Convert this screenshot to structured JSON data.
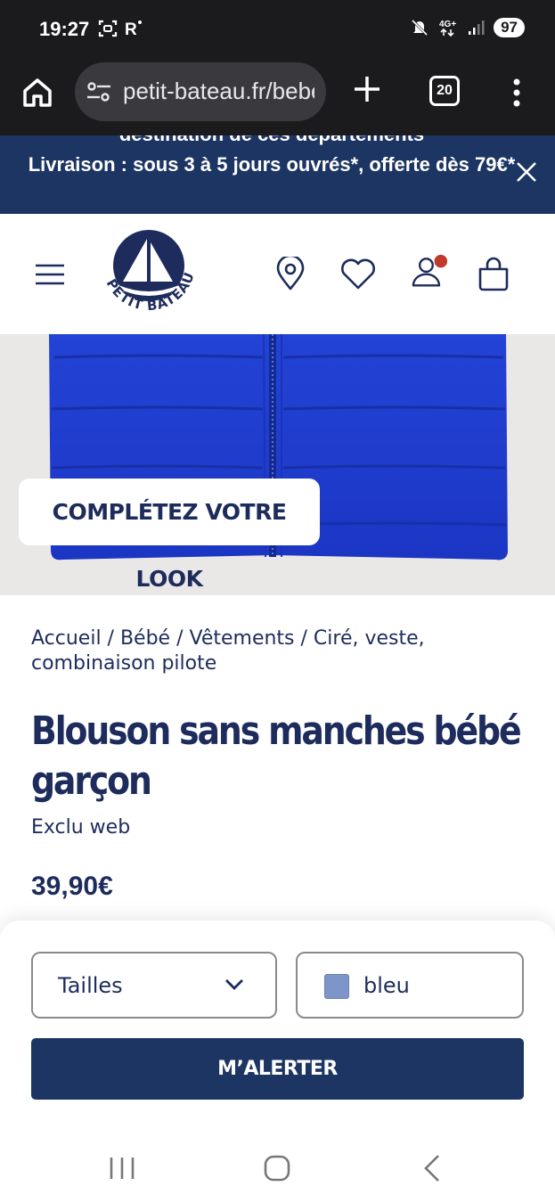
{
  "status_bar": {
    "time": "19:27",
    "left_icons": [
      "screenshot-icon",
      "r-icon"
    ],
    "battery": "97",
    "right_icons": [
      "mute-icon",
      "network-4g-icon",
      "signal-icon",
      "battery-icon"
    ]
  },
  "browser": {
    "url": "petit-bateau.fr/bebe",
    "tab_count": "20",
    "icons": [
      "home-icon",
      "site-settings-icon",
      "new-tab-icon",
      "tabs-icon",
      "more-menu-icon"
    ]
  },
  "promo": {
    "previous_text": "destination de ces départements",
    "text": "Livraison : sous 3 à 5 jours ouvrés*, offerte dès 79€*",
    "close_icon": "close-icon"
  },
  "header": {
    "logo_text": "PETIT BATEAU",
    "icons": [
      "menu-icon",
      "store-locator-icon",
      "wishlist-icon",
      "account-icon",
      "bag-icon"
    ],
    "notification_color": "#c0392b"
  },
  "product": {
    "image_color": "#1f3fd1",
    "look_button": "COMPLÉTEZ VOTRE LOOK",
    "breadcrumb": "Accueil / Bébé / Vêtements / Ciré, veste, combinaison pilote",
    "title": "Blouson sans manches bébé garçon",
    "tag": "Exclu web",
    "price": "39,90€"
  },
  "purchase": {
    "size_label": "Tailles",
    "color_label": "bleu",
    "color_swatch": "#7e95c9",
    "alert_button": "M’ALERTER"
  },
  "nav": {
    "icons": [
      "recent-apps-icon",
      "home-nav-icon",
      "back-icon"
    ]
  },
  "colors": {
    "brand_navy": "#1d3563",
    "text_navy": "#1d2c5c"
  }
}
